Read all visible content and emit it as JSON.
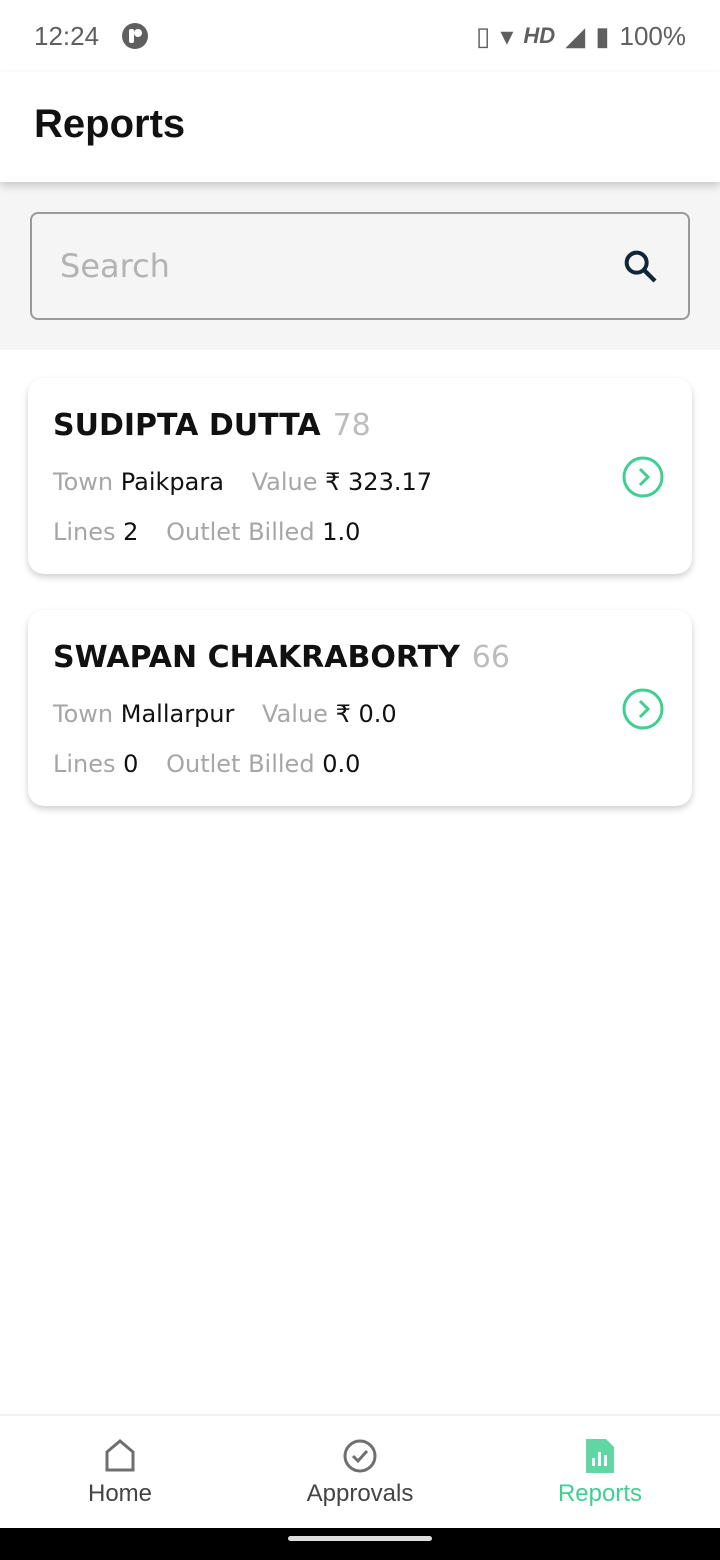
{
  "status": {
    "time": "12:24",
    "network": "HD",
    "battery": "100%"
  },
  "header": {
    "title": "Reports"
  },
  "search": {
    "placeholder": "Search"
  },
  "reports": [
    {
      "name": "SUDIPTA DUTTA",
      "code": "78",
      "town_label": "Town",
      "town": "Paikpara",
      "value_label": "Value",
      "value": "₹ 323.17",
      "lines_label": "Lines",
      "lines": "2",
      "outlet_label": "Outlet Billed",
      "outlet": "1.0"
    },
    {
      "name": "SWAPAN CHAKRABORTY",
      "code": "66",
      "town_label": "Town",
      "town": "Mallarpur",
      "value_label": "Value",
      "value": "₹ 0.0",
      "lines_label": "Lines",
      "lines": "0",
      "outlet_label": "Outlet Billed",
      "outlet": "0.0"
    }
  ],
  "nav": {
    "items": [
      {
        "label": "Home",
        "icon": "home-icon"
      },
      {
        "label": "Approvals",
        "icon": "check-circle-icon"
      },
      {
        "label": "Reports",
        "icon": "report-icon",
        "active": true
      }
    ]
  },
  "colors": {
    "accent": "#3fcf91"
  }
}
